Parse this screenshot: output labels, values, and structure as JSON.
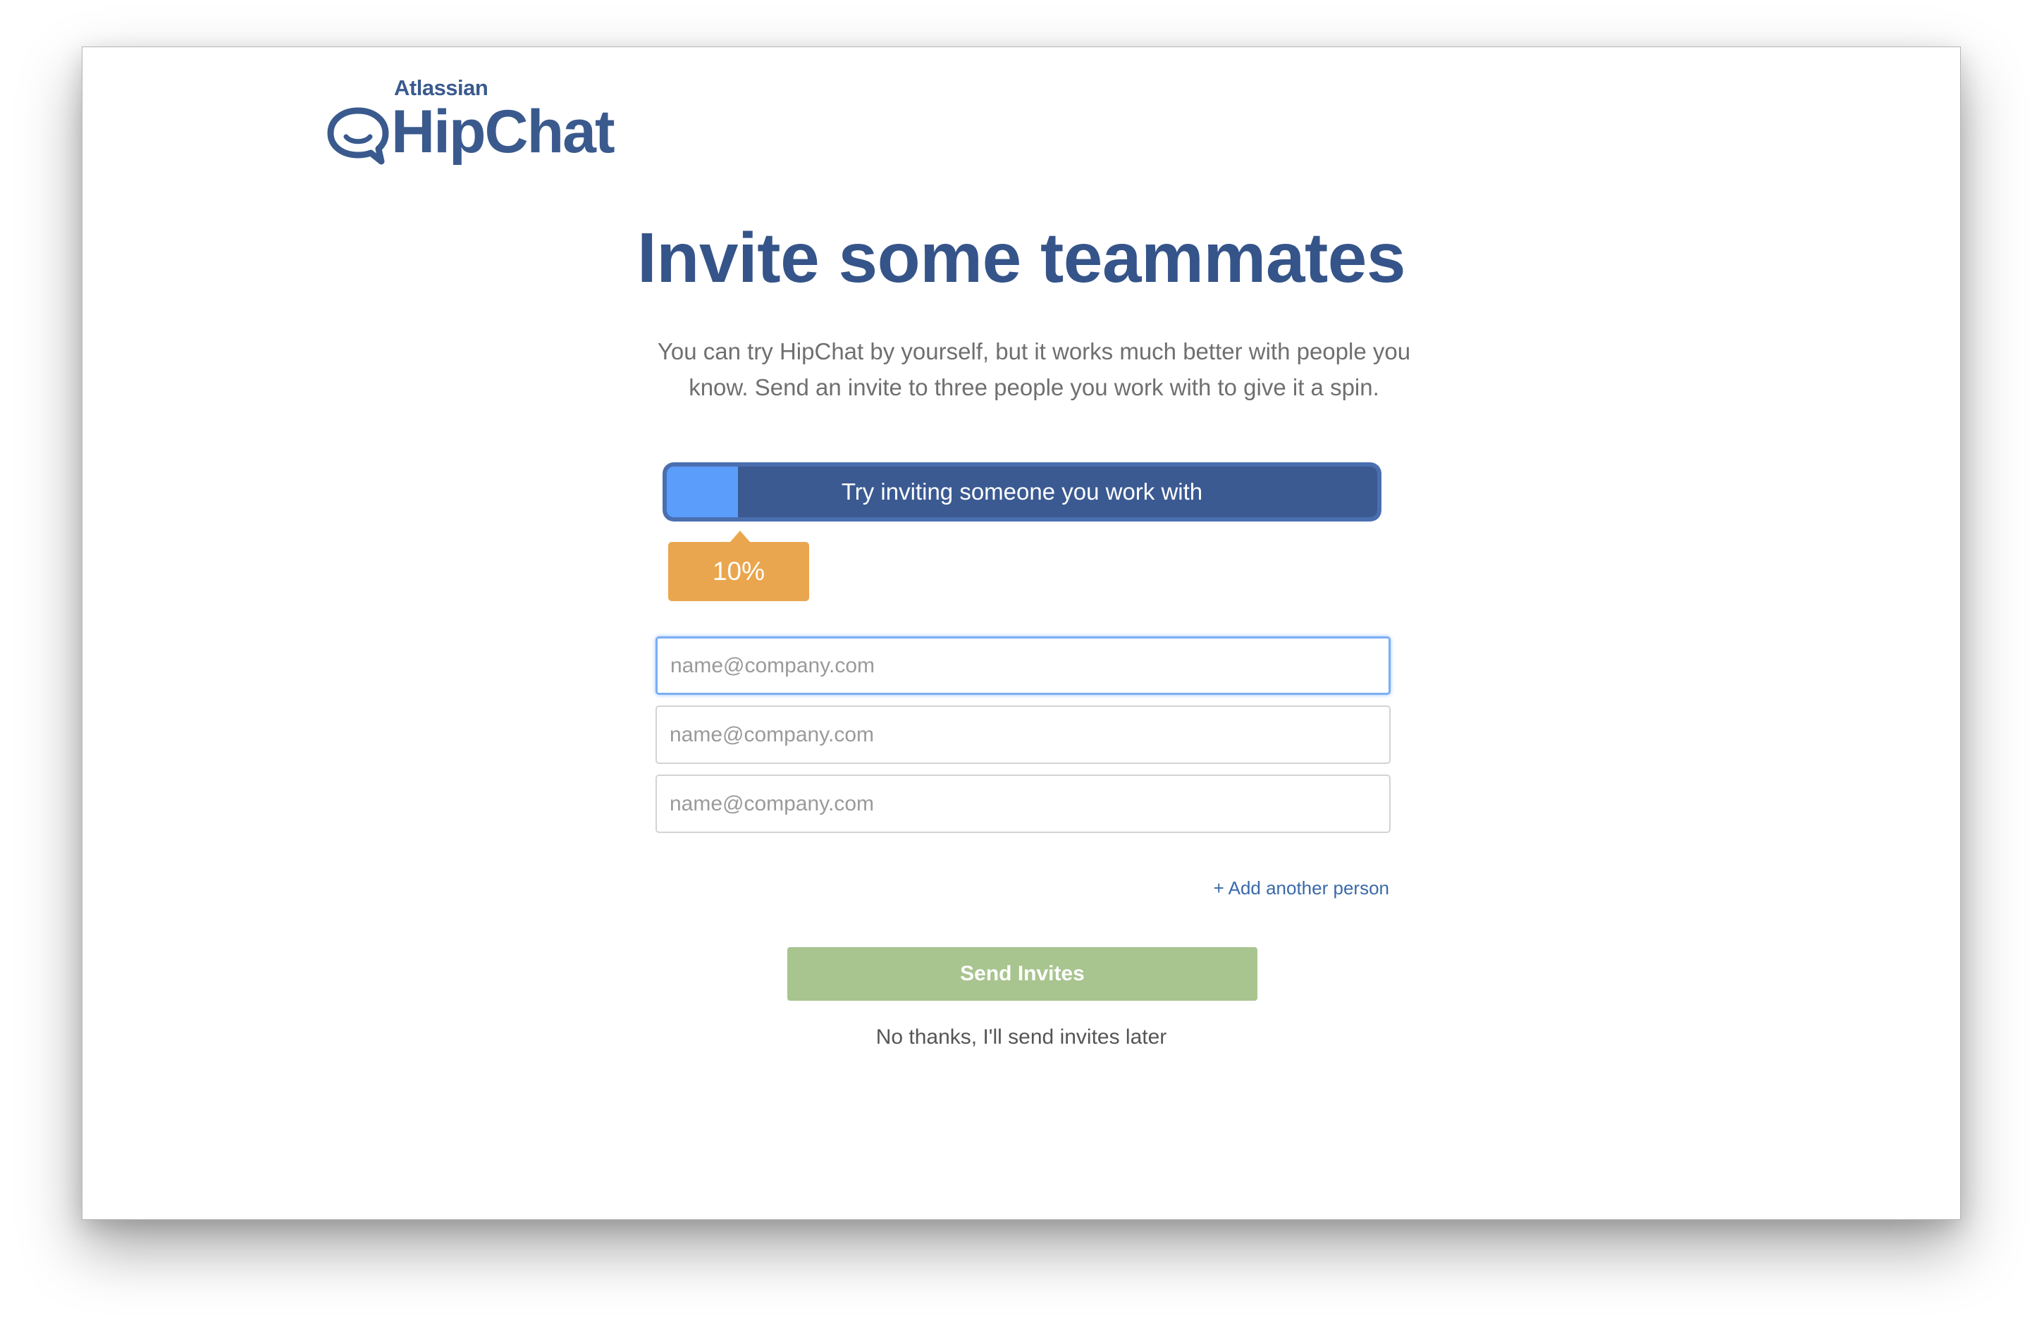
{
  "logo": {
    "company": "Atlassian",
    "product": "HipChat",
    "icon": "chat-bubble-icon"
  },
  "headline": "Invite some teammates",
  "subtext": "You can try HipChat by yourself, but it works much better with people you know. Send an invite to three people you work with to give it a spin.",
  "progress": {
    "label": "Try inviting someone you work with",
    "percent_value": 10,
    "percent_text": "10%"
  },
  "invites": {
    "fields": [
      {
        "value": "",
        "placeholder": "name@company.com",
        "focused": true
      },
      {
        "value": "",
        "placeholder": "name@company.com",
        "focused": false
      },
      {
        "value": "",
        "placeholder": "name@company.com",
        "focused": false
      }
    ],
    "add_another_label": "+ Add another person"
  },
  "actions": {
    "send_label": "Send Invites",
    "skip_label": "No thanks, I'll send invites later"
  },
  "colors": {
    "brand": "#355489",
    "progress_fill": "#5b9dfb",
    "tooltip": "#eaa64e",
    "send_button": "#a8c48f",
    "link": "#3a6aa8"
  }
}
